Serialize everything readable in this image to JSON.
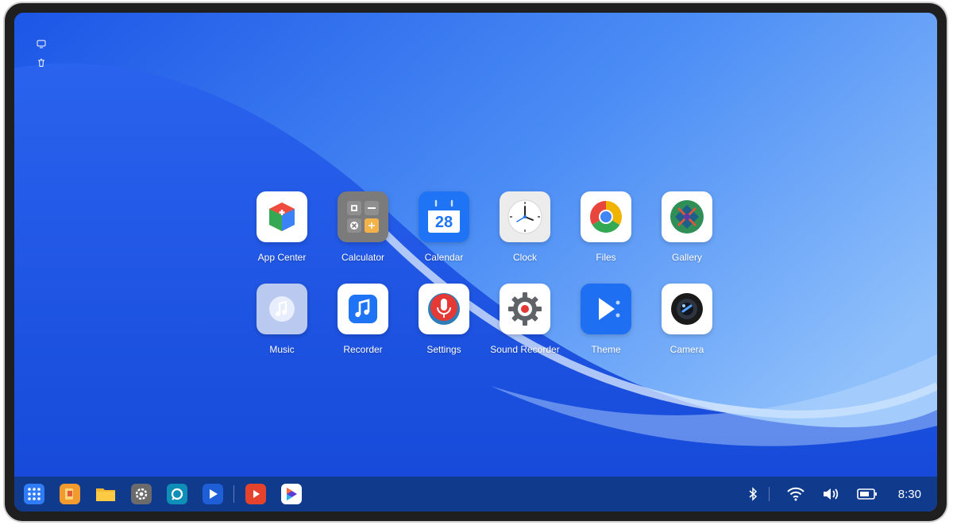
{
  "desktop": {
    "corner_icons": [
      {
        "icon": "monitor-chat-icon"
      },
      {
        "icon": "trash-icon"
      }
    ],
    "apps": [
      {
        "label": "App Center",
        "icon": "app-center-icon"
      },
      {
        "label": "Calculator",
        "icon": "calculator-icon"
      },
      {
        "label": "Calendar",
        "icon": "calendar-icon",
        "day": "28"
      },
      {
        "label": "Clock",
        "icon": "clock-icon"
      },
      {
        "label": "Files",
        "icon": "chrome-icon"
      },
      {
        "label": "Gallery",
        "icon": "gallery-icon"
      },
      {
        "label": "Music",
        "icon": "music-icon"
      },
      {
        "label": "Recorder",
        "icon": "recorder-icon"
      },
      {
        "label": "Settings",
        "icon": "microphone-icon"
      },
      {
        "label": "Sound Recorder",
        "icon": "gear-record-icon"
      },
      {
        "label": "Theme",
        "icon": "play-icon"
      },
      {
        "label": "Camera",
        "icon": "camera-icon"
      }
    ]
  },
  "taskbar": {
    "pinned": [
      {
        "icon": "app-grid-icon"
      },
      {
        "icon": "book-app-icon"
      },
      {
        "icon": "folder-icon"
      },
      {
        "icon": "settings-gear-icon"
      },
      {
        "icon": "chat-icon"
      },
      {
        "icon": "player-icon"
      },
      {
        "icon": "video-icon"
      },
      {
        "icon": "media-player-icon"
      }
    ],
    "tray": [
      {
        "icon": "bluetooth-icon"
      },
      {
        "icon": "wifi-icon"
      },
      {
        "icon": "volume-icon"
      },
      {
        "icon": "battery-icon"
      }
    ],
    "time": "8:30"
  },
  "colors": {
    "wallpaper": "#2f6df0",
    "taskbar": "#103a8c",
    "accent": "#1e74f5"
  }
}
